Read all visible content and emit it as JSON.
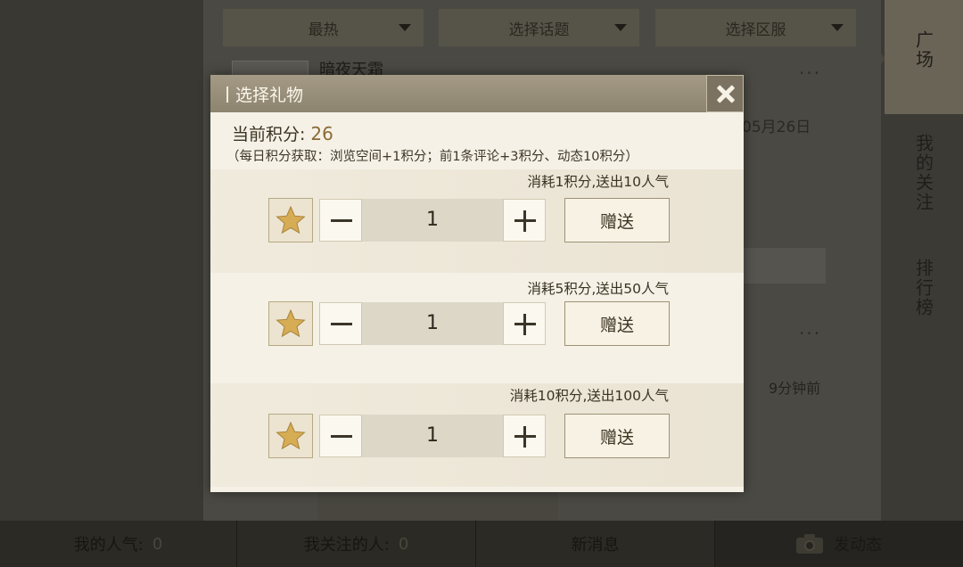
{
  "background": {
    "filters": [
      {
        "label": "最热"
      },
      {
        "label": "选择话题"
      },
      {
        "label": "选择区服"
      }
    ],
    "post": {
      "author": "暗夜天霜",
      "more": "···",
      "date": "05月26日",
      "time_ago": "9分钟前"
    },
    "right_tabs": [
      {
        "label": "广场",
        "active": true
      },
      {
        "label": "我的关注",
        "active": false
      },
      {
        "label": "排行榜",
        "active": false
      }
    ]
  },
  "bottom_bar": {
    "my_popularity": {
      "label": "我的人气:",
      "value": "0"
    },
    "my_following": {
      "label": "我关注的人:",
      "value": "0"
    },
    "new_messages": {
      "label": "新消息"
    },
    "post_update": {
      "label": "发动态",
      "icon": "camera-icon"
    }
  },
  "modal": {
    "title": "选择礼物",
    "close_icon": "close-icon",
    "score_label": "当前积分:",
    "score_value": "26",
    "rules": "（每日积分获取：浏览空间+1积分；前1条评论+3积分、动态10积分）",
    "gifts": [
      {
        "cost_text": "消耗1积分,送出10人气",
        "quantity": "1",
        "send_label": "赠送",
        "icon": "star-icon"
      },
      {
        "cost_text": "消耗5积分,送出50人气",
        "quantity": "1",
        "send_label": "赠送",
        "icon": "star-icon"
      },
      {
        "cost_text": "消耗10积分,送出100人气",
        "quantity": "1",
        "send_label": "赠送",
        "icon": "star-icon"
      }
    ]
  },
  "colors": {
    "modal_bg": "#f5f1e6",
    "header_bg": "#998f7a",
    "score_accent": "#8a6a34",
    "star_gold": "#d6ac55"
  }
}
